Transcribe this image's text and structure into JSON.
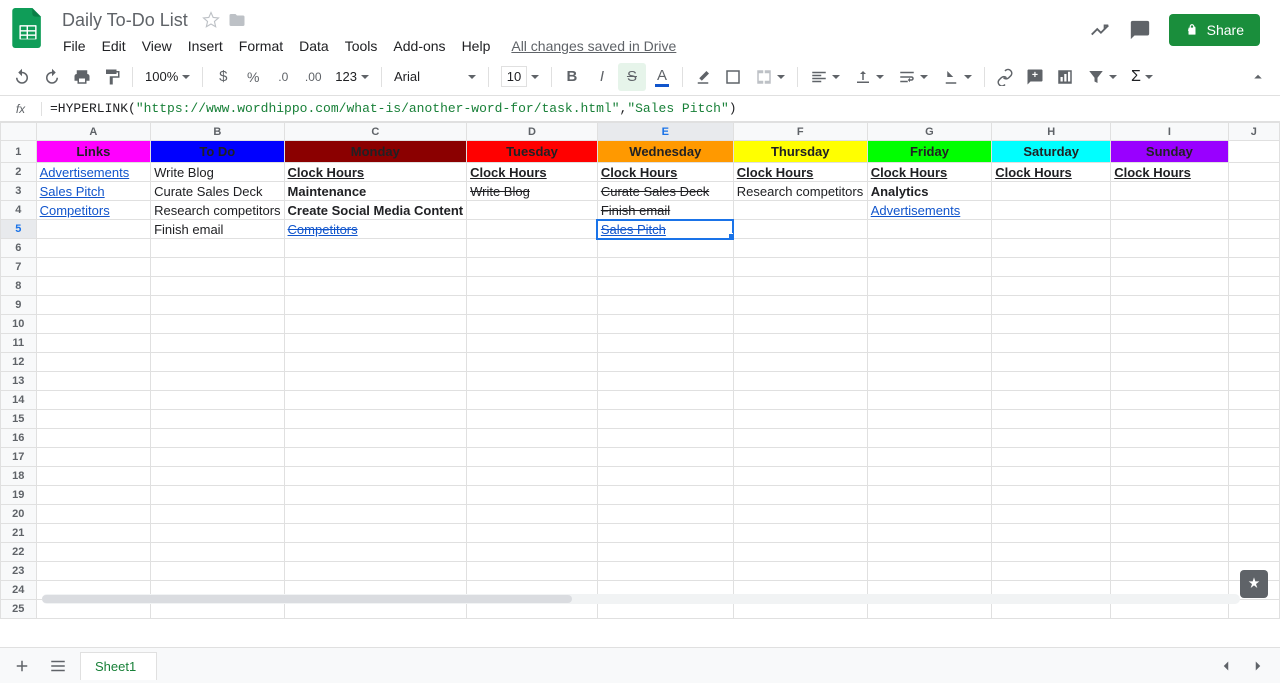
{
  "app": {
    "title": "Daily To-Do List",
    "saved_status": "All changes saved in Drive",
    "share_label": "Share"
  },
  "menus": [
    "File",
    "Edit",
    "View",
    "Insert",
    "Format",
    "Data",
    "Tools",
    "Add-ons",
    "Help"
  ],
  "toolbar": {
    "zoom": "100%",
    "number_format": "123",
    "font_name": "Arial",
    "font_size": "10"
  },
  "formula": {
    "prefix": "=HYPERLINK(",
    "arg1": "\"https://www.wordhippo.com/what-is/another-word-for/task.html\"",
    "sep": ",",
    "arg2": "\"Sales Pitch\"",
    "suffix": ")"
  },
  "columns": [
    "A",
    "B",
    "C",
    "D",
    "E",
    "F",
    "G",
    "H",
    "I",
    "J"
  ],
  "selected": {
    "col": "E",
    "row": 5
  },
  "sheet": {
    "headers": {
      "A": "Links",
      "B": "To Do",
      "C": "Monday",
      "D": "Tuesday",
      "E": "Wednesday",
      "F": "Thursday",
      "G": "Friday",
      "H": "Saturday",
      "I": "Sunday"
    },
    "cells": {
      "A2": {
        "t": "Advertisements",
        "link": true
      },
      "A3": {
        "t": "Sales Pitch",
        "link": true
      },
      "A4": {
        "t": "Competitors",
        "link": true
      },
      "B2": {
        "t": "Write Blog"
      },
      "B3": {
        "t": "Curate Sales Deck"
      },
      "B4": {
        "t": "Research competitors"
      },
      "B5": {
        "t": "Finish email"
      },
      "C2": {
        "t": "Clock Hours",
        "bu": true
      },
      "C3": {
        "t": "Maintenance",
        "b": true
      },
      "C4": {
        "t": "Create Social Media Content",
        "b": true
      },
      "C5": {
        "t": "Competitors",
        "link": true,
        "strike": true
      },
      "D2": {
        "t": "Clock Hours",
        "bu": true
      },
      "D3": {
        "t": "Write Blog",
        "strike": true
      },
      "E2": {
        "t": "Clock Hours",
        "bu": true
      },
      "E3": {
        "t": "Curate Sales Deck",
        "strike": true
      },
      "E4": {
        "t": "Finish email",
        "strike": true
      },
      "E5": {
        "t": "Sales Pitch",
        "link": true,
        "strike": true
      },
      "F2": {
        "t": "Clock Hours",
        "bu": true
      },
      "F3": {
        "t": "Research competitors"
      },
      "G2": {
        "t": "Clock Hours",
        "bu": true
      },
      "G3": {
        "t": "Analytics",
        "b": true
      },
      "G4": {
        "t": "Advertisements",
        "link": true
      },
      "H2": {
        "t": "Clock Hours",
        "bu": true
      },
      "I2": {
        "t": "Clock Hours",
        "bu": true
      }
    }
  },
  "sheet_tab": "Sheet1"
}
